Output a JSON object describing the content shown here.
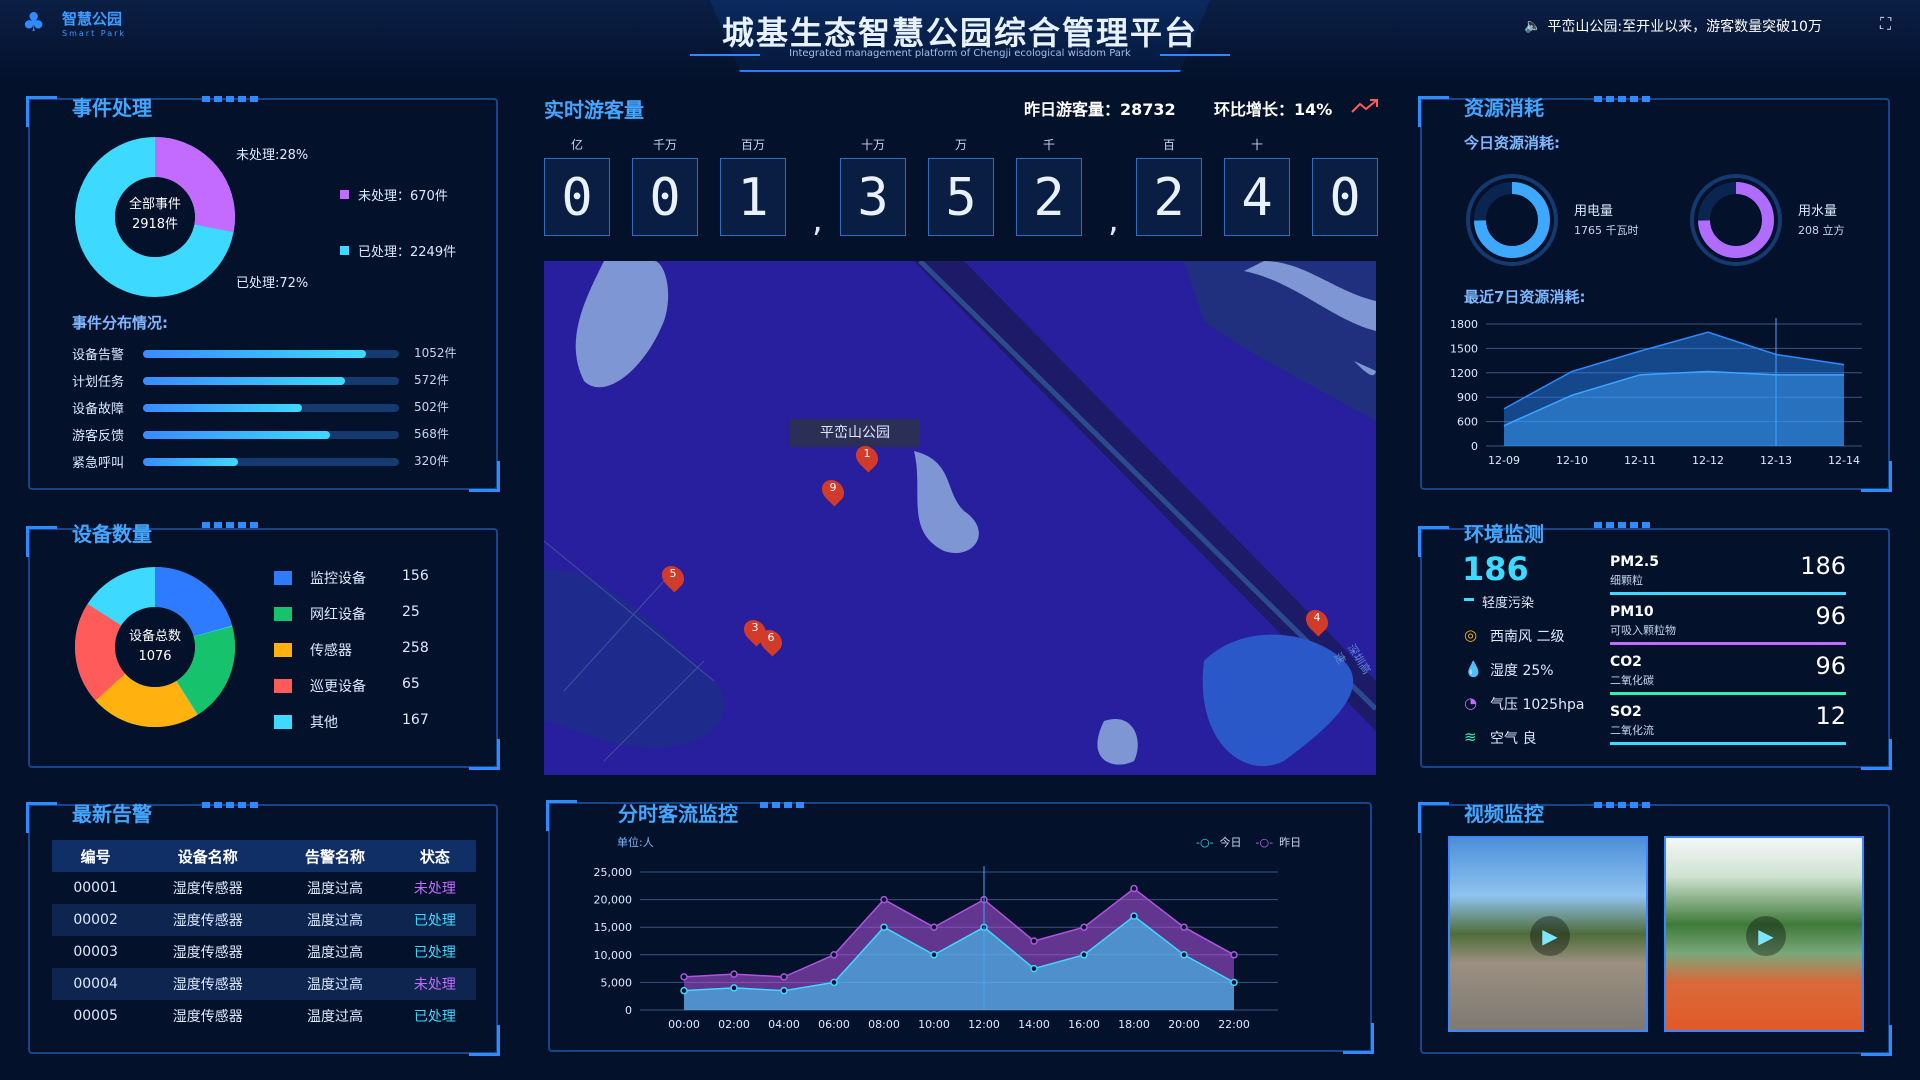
{
  "header": {
    "logo_title": "智慧公园",
    "logo_sub": "Smart Park",
    "title": "城基生态智慧公园综合管理平台",
    "subtitle": "Integrated management platform of Chengji ecological wisdom Park",
    "notice": "平峦山公园:至开业以来，游客数量突破10万"
  },
  "events": {
    "title": "事件处理",
    "center_label": "全部事件",
    "center_value": "2918件",
    "pending_pct": "未处理:28%",
    "done_pct": "已处理:72%",
    "legend_pending": "未处理：670件",
    "legend_done": "已处理：2249件",
    "pending_color": "#c36bff",
    "done_color": "#3ed9ff",
    "dist_title": "事件分布情况:",
    "dist": [
      {
        "label": "设备告警",
        "value": "1052件",
        "fraction": 0.87
      },
      {
        "label": "计划任务",
        "value": "572件",
        "fraction": 0.79
      },
      {
        "label": "设备故障",
        "value": "502件",
        "fraction": 0.62
      },
      {
        "label": "游客反馈",
        "value": "568件",
        "fraction": 0.73
      },
      {
        "label": "紧急呼叫",
        "value": "320件",
        "fraction": 0.37
      }
    ]
  },
  "devices": {
    "title": "设备数量",
    "center_label": "设备总数",
    "center_value": "1076",
    "items": [
      {
        "label": "监控设备",
        "value": "156",
        "color": "#2f7bff"
      },
      {
        "label": "网红设备",
        "value": "25",
        "color": "#16c26b"
      },
      {
        "label": "传感器",
        "value": "258",
        "color": "#ffb20f"
      },
      {
        "label": "巡更设备",
        "value": "65",
        "color": "#ff5b5b"
      },
      {
        "label": "其他",
        "value": "167",
        "color": "#3ed9ff"
      }
    ]
  },
  "alerts": {
    "title": "最新告警",
    "headers": [
      "编号",
      "设备名称",
      "告警名称",
      "状态"
    ],
    "rows": [
      [
        "00001",
        "湿度传感器",
        "温度过高",
        "未处理"
      ],
      [
        "00002",
        "湿度传感器",
        "温度过高",
        "已处理"
      ],
      [
        "00003",
        "湿度传感器",
        "温度过高",
        "已处理"
      ],
      [
        "00004",
        "湿度传感器",
        "温度过高",
        "未处理"
      ],
      [
        "00005",
        "湿度传感器",
        "温度过高",
        "已处理"
      ]
    ]
  },
  "visitors": {
    "title": "实时游客量",
    "yesterday_label": "昨日游客量：",
    "yesterday_value": "28732",
    "growth_label": "环比增长：",
    "growth_value": "14%",
    "digits": [
      {
        "unit": "亿",
        "d": "0"
      },
      {
        "unit": "千万",
        "d": "0"
      },
      {
        "unit": "百万",
        "d": "1"
      },
      {
        "unit": "十万",
        "d": "3"
      },
      {
        "unit": "万",
        "d": "5"
      },
      {
        "unit": "千",
        "d": "2"
      },
      {
        "unit": "百",
        "d": "2"
      },
      {
        "unit": "十",
        "d": "4"
      },
      {
        "unit": "",
        "d": "0"
      }
    ],
    "comma": ","
  },
  "map": {
    "popup": "平峦山公园",
    "markers": [
      "1",
      "9",
      "5",
      "3",
      "6",
      "4"
    ],
    "road_label": "深圳高速"
  },
  "hourly": {
    "title": "分时客流监控",
    "unit": "单位:人",
    "legend_today": "今日",
    "legend_yesterday": "昨日"
  },
  "resources": {
    "title": "资源消耗",
    "today_title": "今日资源消耗:",
    "electric_label": "用电量",
    "electric_value": "1765 千瓦时",
    "water_label": "用水量",
    "water_value": "208 立方",
    "week_title": "最近7日资源消耗:"
  },
  "env": {
    "title": "环境监测",
    "aqi": "186",
    "aqi_desc": "轻度污染",
    "wind": "西南风 二级",
    "humidity": "湿度 25%",
    "pressure": "气压 1025hpa",
    "air": "空气 良",
    "metrics": [
      {
        "name": "PM2.5",
        "desc": "细颗粒",
        "value": "186",
        "color": "#3ed9ff"
      },
      {
        "name": "PM10",
        "desc": "可吸入颗粒物",
        "value": "96",
        "color": "#c36bff"
      },
      {
        "name": "CO2",
        "desc": "二氧化碳",
        "value": "96",
        "color": "#37f0b0"
      },
      {
        "name": "SO2",
        "desc": "二氧化流",
        "value": "12",
        "color": "#3ed9ff"
      }
    ]
  },
  "video": {
    "title": "视频监控"
  },
  "chart_data": [
    {
      "type": "area",
      "x": [
        "00:00",
        "02:00",
        "04:00",
        "06:00",
        "08:00",
        "10:00",
        "12:00",
        "14:00",
        "16:00",
        "18:00",
        "20:00",
        "22:00"
      ],
      "series": [
        {
          "name": "今日",
          "values": [
            3500,
            4000,
            3500,
            5000,
            15000,
            10000,
            15000,
            7500,
            10000,
            17000,
            10000,
            5000
          ]
        },
        {
          "name": "昨日",
          "values": [
            6000,
            6500,
            6000,
            10000,
            20000,
            15000,
            20000,
            12500,
            15000,
            22000,
            15000,
            10000
          ]
        }
      ],
      "ylim": [
        0,
        25000
      ],
      "yticks": [
        "0",
        "5,000",
        "10,000",
        "15,000",
        "20,000",
        "25,000"
      ],
      "ylabel": "单位:人",
      "colors": {
        "今日": "#3ed9ff",
        "昨日": "#b054e0"
      }
    },
    {
      "type": "area",
      "x": [
        "12-09",
        "12-10",
        "12-11",
        "12-12",
        "12-13",
        "12-14"
      ],
      "series": [
        {
          "values": [
            550,
            1100,
            1400,
            1680,
            1350,
            1200
          ]
        },
        {
          "values": [
            300,
            750,
            1050,
            1100,
            1050,
            1050
          ]
        }
      ],
      "ylim": [
        0,
        1800
      ],
      "yticks": [
        "0",
        "600",
        "900",
        "1200",
        "1500",
        "1800"
      ]
    }
  ]
}
